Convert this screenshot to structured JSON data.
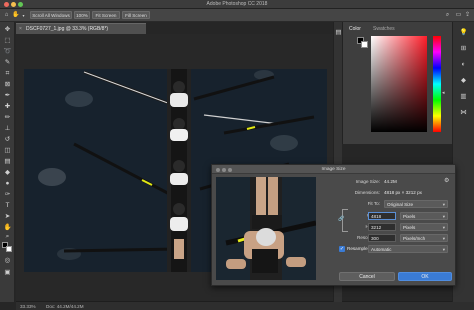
{
  "window": {
    "title": "Adobe Photoshop CC 2018",
    "traffic_colors": [
      "#ed6a5e",
      "#f5bf4f",
      "#62c655"
    ]
  },
  "options_bar": {
    "buttons": [
      "Scroll All Windows",
      "100%",
      "Fit Screen",
      "Fill Screen"
    ]
  },
  "document": {
    "tab_label": "DSCF0727_1.jpg @ 33.3% (RGB/8*)",
    "status_zoom": "33.33%",
    "status_doc": "Doc: 44.2M/44.2M"
  },
  "color_panel": {
    "tabs": [
      "Color",
      "Swatches"
    ],
    "accent": "#ff1e2a"
  },
  "image_size_dialog": {
    "title": "Image Size",
    "image_size_label": "Image Size:",
    "image_size_value": "44.2M",
    "dimensions_label": "Dimensions:",
    "dimensions_value": "4818 px  ×  3212 px",
    "fit_to_label": "Fit To:",
    "fit_to_value": "Original Size",
    "width_label": "Width:",
    "width_value": "4818",
    "width_unit": "Pixels",
    "height_label": "Height:",
    "height_value": "3212",
    "height_unit": "Pixels",
    "resolution_label": "Resolution:",
    "resolution_value": "300",
    "resolution_unit": "Pixels/Inch",
    "resample_label": "Resample:",
    "resample_value": "Automatic",
    "cancel_label": "Cancel",
    "ok_label": "OK",
    "ok_color": "#3a7bd5"
  }
}
